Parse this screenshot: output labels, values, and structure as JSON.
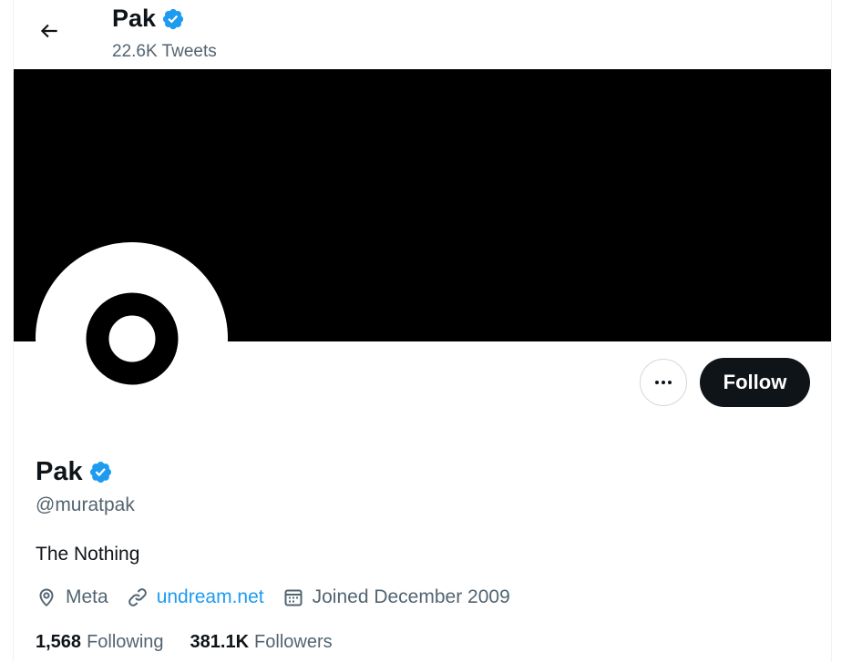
{
  "header": {
    "title": "Pak",
    "subtitle": "22.6K Tweets",
    "back_icon": "arrow-left-icon",
    "verified_icon": "verified-badge-icon"
  },
  "profile": {
    "name": "Pak",
    "handle": "@muratpak",
    "bio": "The Nothing",
    "location": "Meta",
    "website": "undream.net",
    "joined": "Joined December 2009",
    "following_count": "1,568",
    "following_label": "Following",
    "followers_count": "381.1K",
    "followers_label": "Followers"
  },
  "actions": {
    "more_icon": "more-horizontal-icon",
    "follow_label": "Follow"
  },
  "colors": {
    "accent": "#1d9bf0",
    "text_primary": "#0f1419",
    "text_secondary": "#536471",
    "banner": "#000000",
    "follow_bg": "#0f1419"
  }
}
